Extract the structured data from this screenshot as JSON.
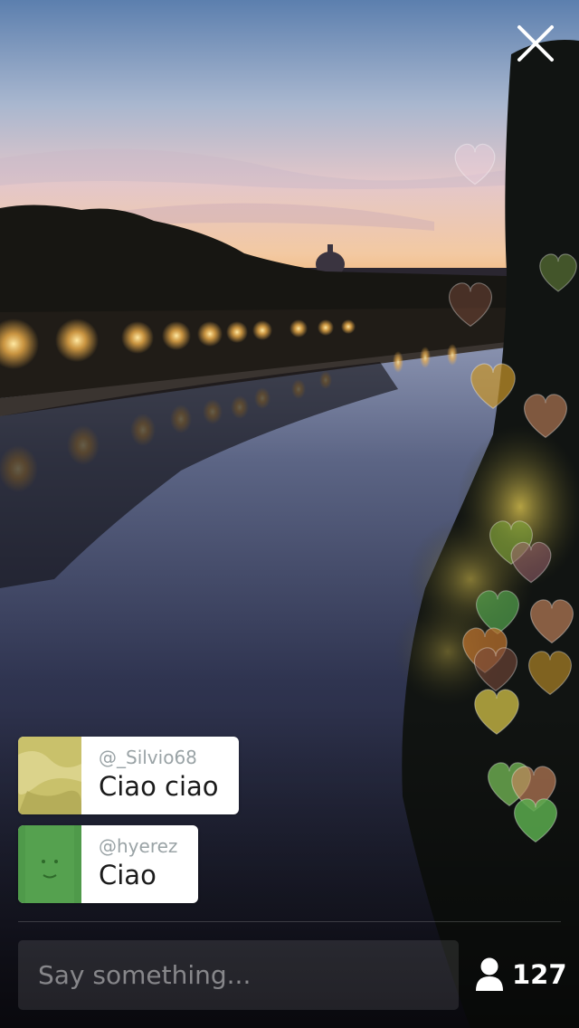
{
  "controls": {
    "close_icon": "close-icon"
  },
  "comments": [
    {
      "username": "@_Silvio68",
      "message": "Ciao ciao",
      "avatar_color": "#c9c16b"
    },
    {
      "username": "@hyerez",
      "message": "Ciao",
      "avatar_color": "#4f9a4a"
    }
  ],
  "composer": {
    "placeholder": "Say something...",
    "value": ""
  },
  "viewers": {
    "icon": "person-icon",
    "count": "127"
  },
  "heart_colors": [
    "#f3d5e0",
    "#6e8a3e",
    "#7a4a3a",
    "#c9962a",
    "#c9865e",
    "#7ea63a",
    "#9a6270",
    "#4f9a4a",
    "#b8702e",
    "#c8b845",
    "#6aa84f",
    "#5aab4e"
  ]
}
